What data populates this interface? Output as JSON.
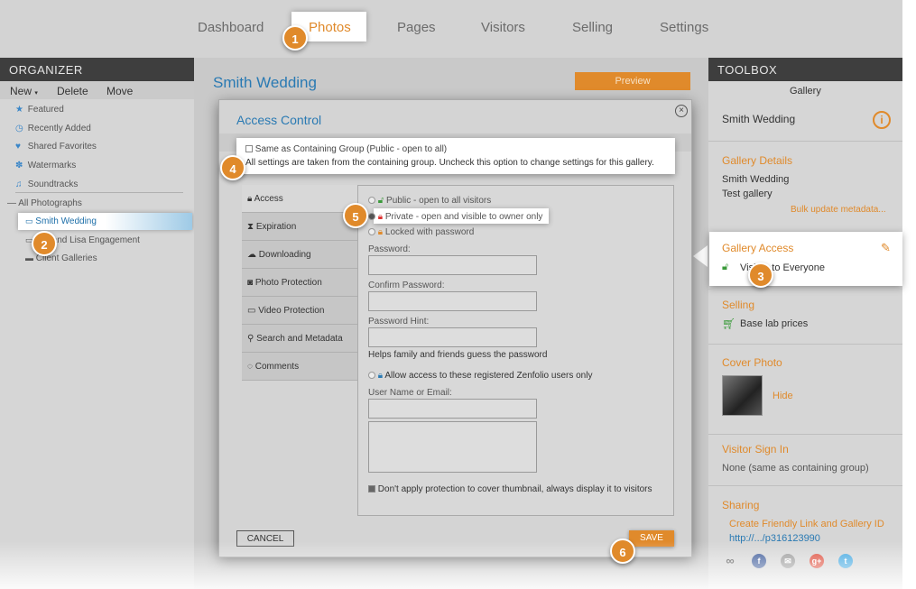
{
  "nav": {
    "items": [
      "Dashboard",
      "Photos",
      "Pages",
      "Visitors",
      "Selling",
      "Settings"
    ]
  },
  "organizer": {
    "header": "ORGANIZER",
    "new_label": "New",
    "delete_label": "Delete",
    "move_label": "Move",
    "favorites": [
      "Featured",
      "Recently Added",
      "Shared Favorites",
      "Watermarks",
      "Soundtracks"
    ],
    "tree_root": "All Photographs",
    "tree_items": [
      "Smith Wedding",
      "Jim and Lisa Engagement",
      "Client Galleries"
    ]
  },
  "gallery": {
    "title": "Smith Wedding",
    "preview_label": "Preview"
  },
  "toolbox": {
    "header": "TOOLBOX",
    "gallery_label": "Gallery",
    "gallery_name": "Smith Wedding",
    "details_heading": "Gallery Details",
    "details_name": "Smith Wedding",
    "details_desc": "Test gallery",
    "bulk_link": "Bulk update metadata...",
    "access_heading": "Gallery Access",
    "access_value": "Visible to Everyone",
    "selling_heading": "Selling",
    "selling_value": "Base lab prices",
    "cover_heading": "Cover Photo",
    "cover_hide": "Hide",
    "signin_heading": "Visitor Sign In",
    "signin_value": "None (same as containing group)",
    "sharing_heading": "Sharing",
    "sharing_link1": "Create Friendly Link and Gallery ID",
    "sharing_link2": "http://.../p316123990"
  },
  "modal": {
    "title": "Access Control",
    "same_label": "Same as Containing Group (Public - open to all)",
    "same_desc": "All settings are taken from the containing group. Uncheck this option to change settings for this gallery.",
    "tabs": [
      "Access",
      "Expiration",
      "Downloading",
      "Photo Protection",
      "Video Protection",
      "Search and Metadata",
      "Comments"
    ],
    "opt_public": "Public - open to all visitors",
    "opt_private": "Private - open and visible to owner only",
    "opt_locked": "Locked with password",
    "password_label": "Password:",
    "confirm_label": "Confirm Password:",
    "hint_label": "Password Hint:",
    "hint_help": "Helps family and friends guess the password",
    "allow_label": "Allow access to these registered Zenfolio users only",
    "user_label": "User Name or Email:",
    "thumb_label": "Don't apply protection to cover thumbnail, always display it to visitors",
    "cancel_label": "CANCEL",
    "save_label": "SAVE"
  },
  "badges": [
    "1",
    "2",
    "3",
    "4",
    "5",
    "6"
  ]
}
